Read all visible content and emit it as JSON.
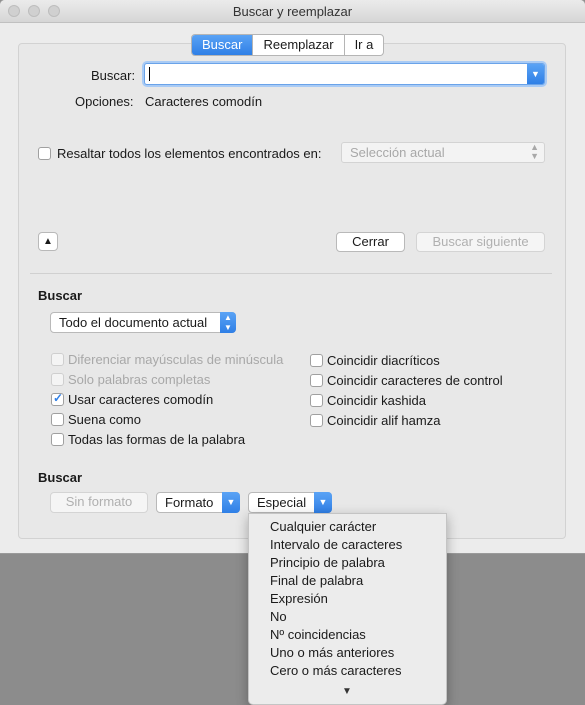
{
  "window": {
    "title": "Buscar y reemplazar"
  },
  "tabs": [
    {
      "label": "Buscar",
      "active": true
    },
    {
      "label": "Reemplazar",
      "active": false
    },
    {
      "label": "Ir a",
      "active": false
    }
  ],
  "search": {
    "label": "Buscar:",
    "value": ""
  },
  "options": {
    "label": "Opciones:",
    "value": "Caracteres comodín"
  },
  "highlight": {
    "label": "Resaltar todos los elementos encontrados en:",
    "checked": false,
    "select_value": "Selección actual"
  },
  "buttons": {
    "close": "Cerrar",
    "find_next": "Buscar siguiente"
  },
  "search_section": {
    "heading": "Buscar",
    "scope_value": "Todo el documento actual",
    "left_options": [
      {
        "label": "Diferenciar mayúsculas de minúscula",
        "checked": false,
        "disabled": true
      },
      {
        "label": "Solo palabras completas",
        "checked": false,
        "disabled": true
      },
      {
        "label": "Usar caracteres comodín",
        "checked": true,
        "disabled": false
      },
      {
        "label": "Suena como",
        "checked": false,
        "disabled": false
      },
      {
        "label": "Todas las formas de la palabra",
        "checked": false,
        "disabled": false
      }
    ],
    "right_options": [
      {
        "label": "Coincidir diacríticos",
        "checked": false
      },
      {
        "label": "Coincidir caracteres de control",
        "checked": false
      },
      {
        "label": "Coincidir kashida",
        "checked": false
      },
      {
        "label": "Coincidir alif hamza",
        "checked": false
      }
    ]
  },
  "format_section": {
    "heading": "Buscar",
    "no_format": "Sin formato",
    "format": "Formato",
    "special": "Especial"
  },
  "special_menu": [
    "Cualquier carácter",
    "Intervalo de caracteres",
    "Principio de palabra",
    "Final de palabra",
    "Expresión",
    "No",
    "Nº coincidencias",
    "Uno o más anteriores",
    "Cero o más caracteres"
  ],
  "colors": {
    "accent": "#2f7fe6",
    "disabled_text": "#a8a8a8"
  }
}
